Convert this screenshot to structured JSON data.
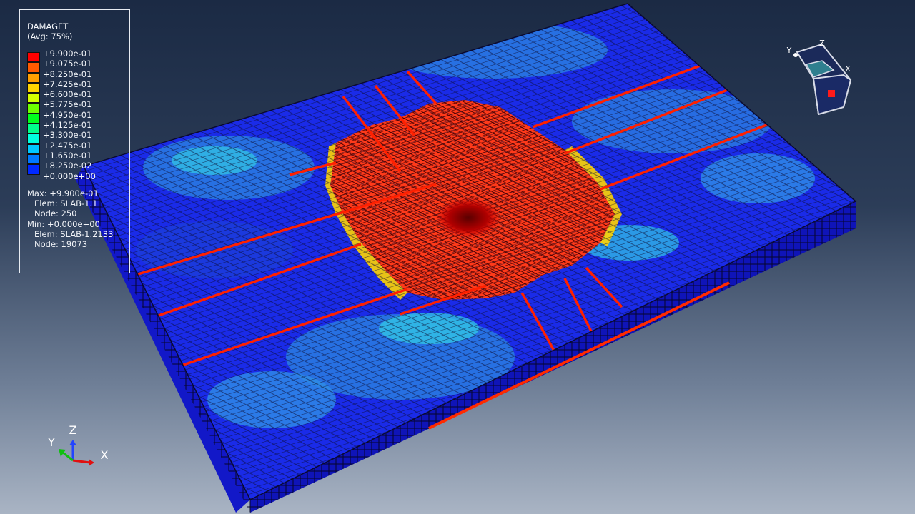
{
  "legend": {
    "variable": "DAMAGET",
    "averaging": "(Avg: 75%)",
    "levels": [
      {
        "value": "+9.900e-01",
        "color": "#ff0000"
      },
      {
        "value": "+9.075e-01",
        "color": "#ff5a00"
      },
      {
        "value": "+8.250e-01",
        "color": "#ff9f00"
      },
      {
        "value": "+7.425e-01",
        "color": "#ffd400"
      },
      {
        "value": "+6.600e-01",
        "color": "#d4ff00"
      },
      {
        "value": "+5.775e-01",
        "color": "#6cff00"
      },
      {
        "value": "+4.950e-01",
        "color": "#00ff1e"
      },
      {
        "value": "+4.125e-01",
        "color": "#00ff8c"
      },
      {
        "value": "+3.300e-01",
        "color": "#00ffe0"
      },
      {
        "value": "+2.475e-01",
        "color": "#00c8ff"
      },
      {
        "value": "+1.650e-01",
        "color": "#0078ff"
      },
      {
        "value": "+8.250e-02",
        "color": "#0028ff"
      },
      {
        "value": "+0.000e+00",
        "color": "#0000e0"
      }
    ],
    "max_label": "Max: +9.900e-01",
    "max_elem": "Elem: SLAB-1.1",
    "max_node": "Node: 250",
    "min_label": "Min: +0.000e+00",
    "min_elem": "Elem: SLAB-1.2133",
    "min_node": "Node: 19073"
  },
  "triad": {
    "x": "X",
    "y": "Y",
    "z": "Z"
  },
  "view_cube": {
    "x": "X",
    "y": "Y",
    "z": "Z"
  },
  "colors": {
    "damage_high": "#ff0000",
    "damage_low": "#0000e0",
    "mesh_line": "#0a0a30"
  }
}
